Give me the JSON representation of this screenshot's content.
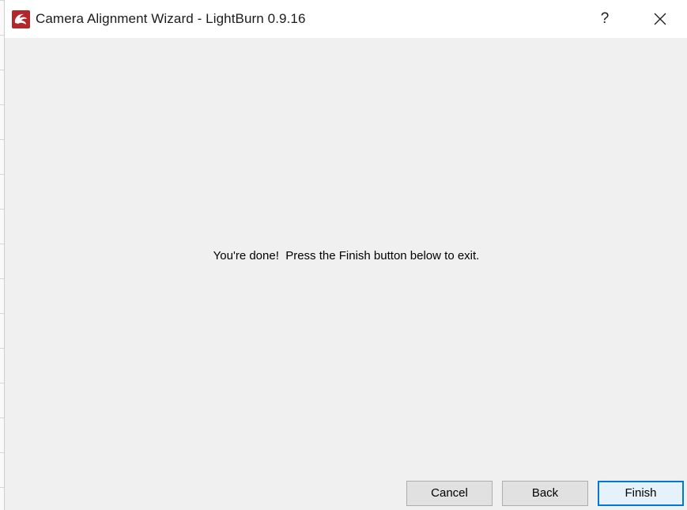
{
  "window": {
    "title": "Camera Alignment Wizard - LightBurn 0.9.16",
    "icon": "lightburn-logo-icon",
    "help_label": "?",
    "close_icon": "close-icon"
  },
  "content": {
    "message": "You're done!  Press the Finish button below to exit."
  },
  "buttons": {
    "cancel": "Cancel",
    "back": "Back",
    "finish": "Finish"
  },
  "colors": {
    "dialog_bg": "#f0f0f0",
    "titlebar_bg": "#ffffff",
    "button_bg": "#e1e1e1",
    "default_button_border": "#0078d7",
    "logo_red": "#b3262c"
  }
}
